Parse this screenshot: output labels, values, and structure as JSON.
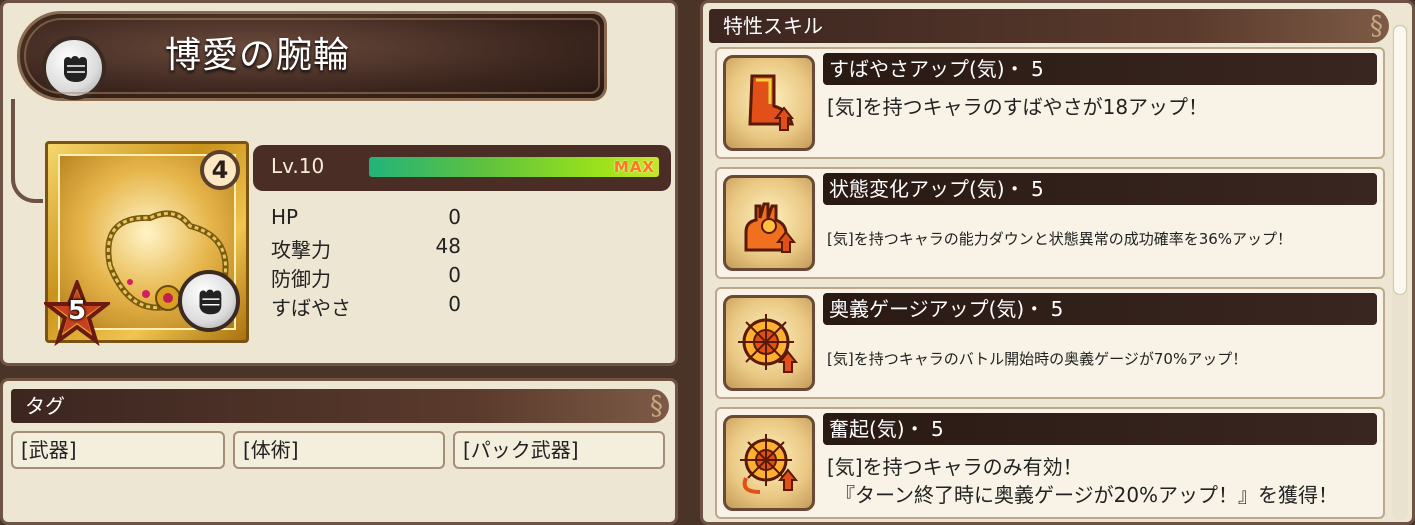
{
  "item": {
    "name": "博愛の腕輪",
    "level_label": "Lv.10",
    "exp_fraction": 1.0,
    "max_label": "MAX",
    "rank": "4",
    "rarity": "5",
    "stats": [
      {
        "name": "HP",
        "value": "0"
      },
      {
        "name": "攻撃力",
        "value": "48"
      },
      {
        "name": "防御力",
        "value": "0"
      },
      {
        "name": "すばやさ",
        "value": "0"
      }
    ]
  },
  "tags": {
    "header": "タグ",
    "items": [
      "[武器]",
      "[体術]",
      "[パック武器]"
    ]
  },
  "skills": {
    "header": "特性スキル",
    "items": [
      {
        "title": "すばやさアップ(気)・ 5",
        "desc": "[気]を持つキャラのすばやさが18アップ！",
        "desc2": "",
        "icon": "boot-icon",
        "small": false
      },
      {
        "title": "状態変化アップ(気)・ 5",
        "desc": "[気]を持つキャラの能力ダウンと状態異常の成功確率を36%アップ！",
        "desc2": "",
        "icon": "status-icon",
        "small": true
      },
      {
        "title": "奥義ゲージアップ(気)・ 5",
        "desc": "[気]を持つキャラのバトル開始時の奥義ゲージが70%アップ！",
        "desc2": "",
        "icon": "gauge-icon",
        "small": true
      },
      {
        "title": "奮起(気)・ 5",
        "desc": "[気]を持つキャラのみ有効！",
        "desc2": "『ターン終了時に奥義ゲージが20%アップ！』を獲得！",
        "icon": "rouse-icon",
        "small": false
      }
    ]
  },
  "colors": {
    "accent_dark": "#4a2e25",
    "exp_bar": "#9be21a",
    "max_text": "#ff7a1a"
  }
}
